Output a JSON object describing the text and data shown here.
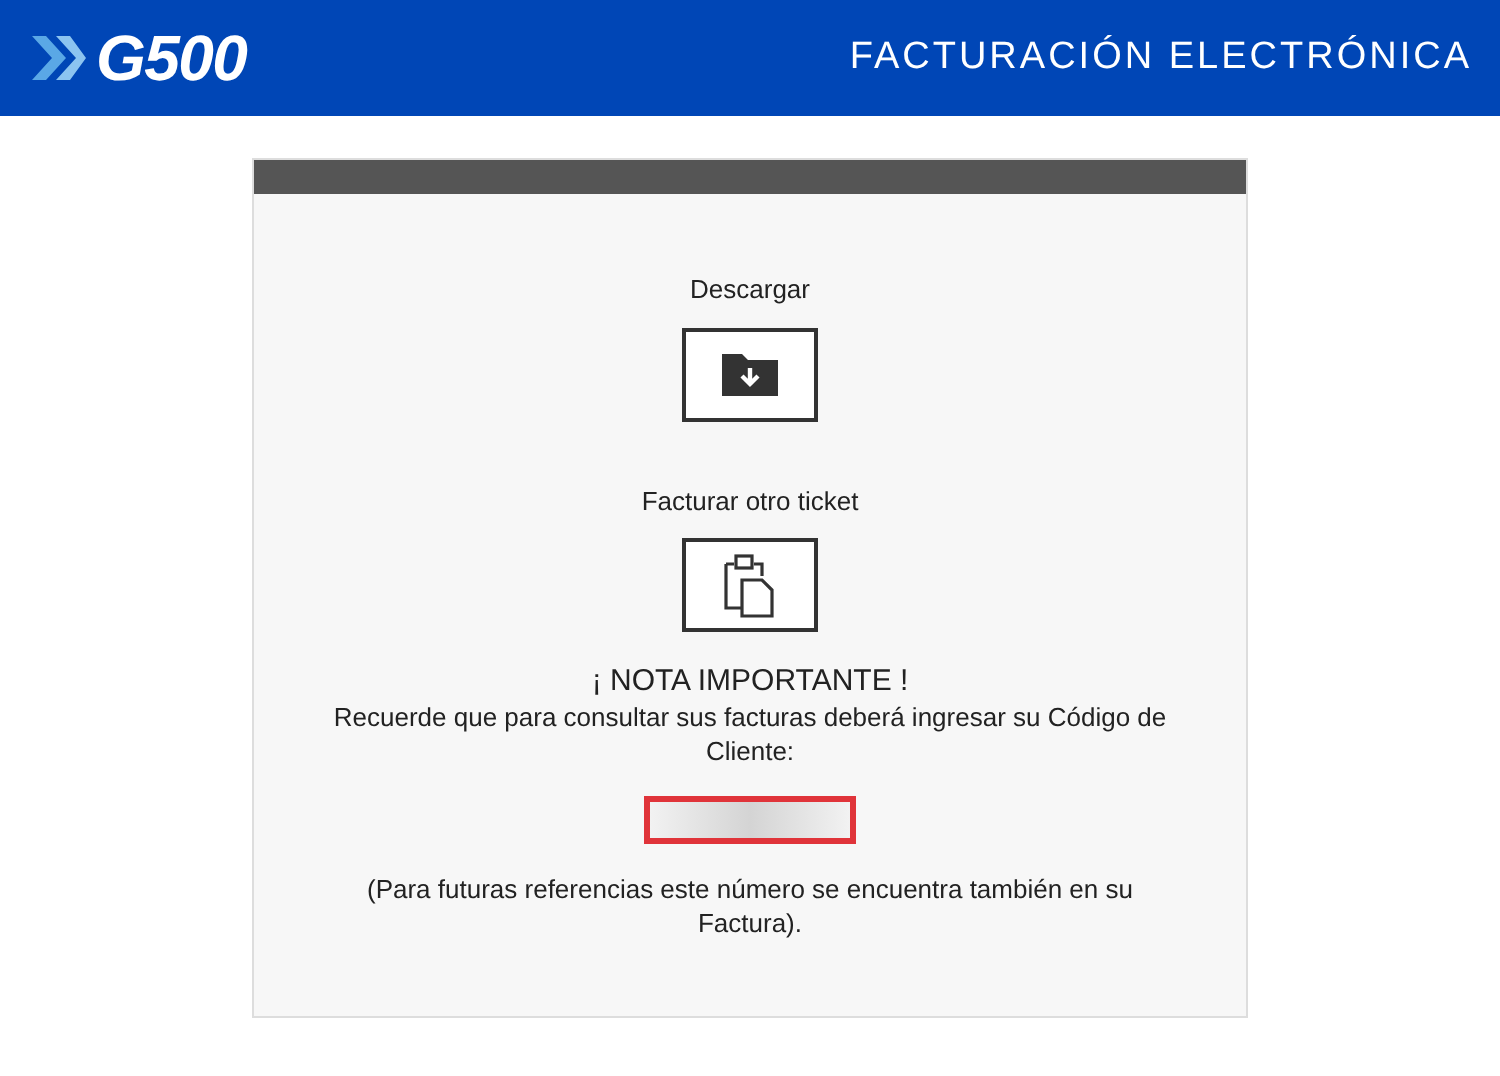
{
  "header": {
    "logo": "G500",
    "title": "FACTURACIÓN ELECTRÓNICA"
  },
  "actions": [
    {
      "label": "Descargar",
      "kind": "download"
    },
    {
      "label": "Facturar otro ticket",
      "kind": "new"
    }
  ],
  "note": {
    "title": "¡ NOTA IMPORTANTE !",
    "text": "Recuerde que para consultar sus facturas deberá ingresar su Código de Cliente:",
    "footer": "(Para futuras referencias este número se encuentra también en su Factura)."
  }
}
